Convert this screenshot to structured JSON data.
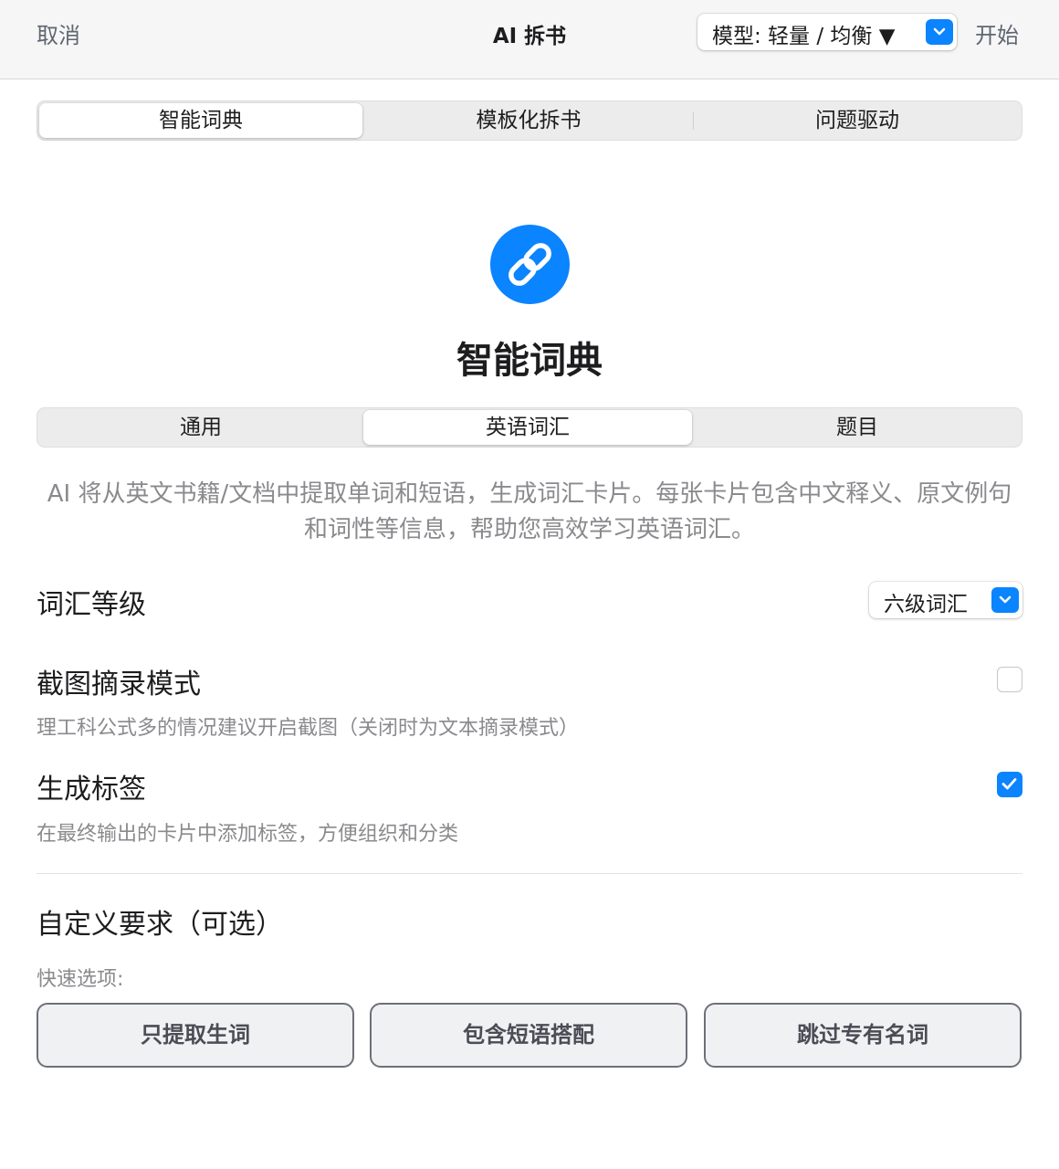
{
  "toolbar": {
    "cancel_label": "取消",
    "title": "AI 拆书",
    "model_select_value": "模型: 轻量 / 均衡 ▼",
    "start_label": "开始"
  },
  "mode_tabs": [
    {
      "label": "智能词典",
      "active": true
    },
    {
      "label": "模板化拆书",
      "active": false
    },
    {
      "label": "问题驱动",
      "active": false
    }
  ],
  "hero": {
    "icon": "link-icon",
    "title": "智能词典"
  },
  "sub_tabs": [
    {
      "label": "通用",
      "active": false
    },
    {
      "label": "英语词汇",
      "active": true
    },
    {
      "label": "题目",
      "active": false
    }
  ],
  "description": "AI 将从英文书籍/文档中提取单词和短语，生成词汇卡片。每张卡片包含中文释义、原文例句和词性等信息，帮助您高效学习英语词汇。",
  "vocab_level": {
    "label": "词汇等级",
    "value": "六级词汇"
  },
  "screenshot_mode": {
    "label": "截图摘录模式",
    "hint": "理工科公式多的情况建议开启截图（关闭时为文本摘录模式）",
    "checked": false
  },
  "generate_tags": {
    "label": "生成标签",
    "hint": "在最终输出的卡片中添加标签，方便组织和分类",
    "checked": true
  },
  "custom": {
    "title": "自定义要求（可选）",
    "quick_label": "快速选项:",
    "options": [
      "只提取生词",
      "包含短语搭配",
      "跳过专有名词"
    ]
  },
  "colors": {
    "accent": "#0a84ff",
    "secondary_text": "#8a8a8e",
    "toolbar_bg": "#f6f6f6"
  }
}
